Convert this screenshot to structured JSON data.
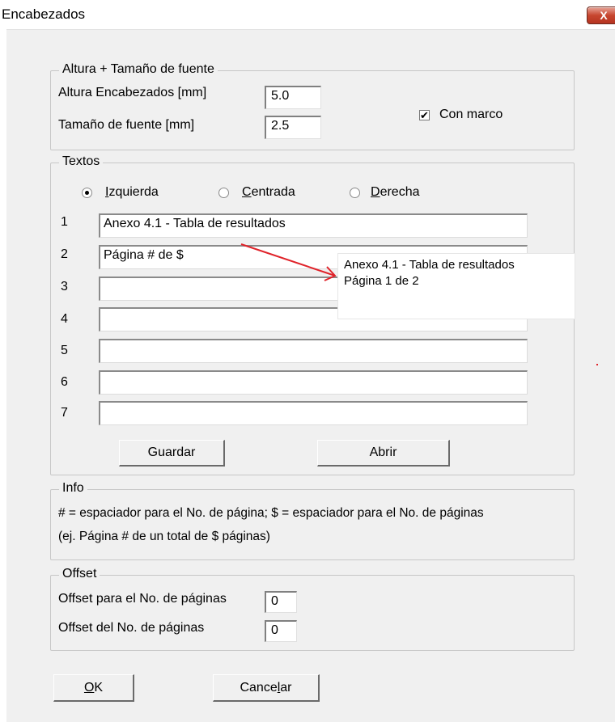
{
  "window": {
    "title": "Encabezados",
    "close_label": "X"
  },
  "group_height": {
    "legend": "Altura + Tamaño de fuente",
    "height_label": "Altura Encabezados [mm]",
    "height_value": "5.0",
    "font_label": "Tamaño de fuente [mm]",
    "font_value": "2.5",
    "frame_checked": true,
    "frame_label": "Con marco"
  },
  "group_texts": {
    "legend": "Textos",
    "alignment": [
      {
        "accel": "I",
        "rest": "zquierda",
        "selected": true
      },
      {
        "accel": "C",
        "rest": "entrada",
        "selected": false
      },
      {
        "accel": "D",
        "rest": "erecha",
        "selected": false
      }
    ],
    "rows": [
      {
        "num": "1",
        "value": "Anexo 4.1 - Tabla de resultados"
      },
      {
        "num": "2",
        "value": "Página # de $"
      },
      {
        "num": "3",
        "value": ""
      },
      {
        "num": "4",
        "value": ""
      },
      {
        "num": "5",
        "value": ""
      },
      {
        "num": "6",
        "value": ""
      },
      {
        "num": "7",
        "value": ""
      }
    ],
    "save_label": "Guardar",
    "open_label": "Abrir"
  },
  "preview": {
    "line1": "Anexo 4.1 - Tabla de resultados",
    "line2": "Página 1 de 2",
    "arrow_color": "#e0232a"
  },
  "group_info": {
    "legend": "Info",
    "line1": "# = espaciador para el No. de página; $ = espaciador para el No. de páginas",
    "line2": "(ej. Página # de un total de $ páginas)"
  },
  "group_offset": {
    "legend": "Offset",
    "pages_label": "Offset para el No. de páginas",
    "pages_value": "0",
    "page_label": "Offset del No. de páginas",
    "page_value": "0"
  },
  "footer": {
    "ok_accel": "O",
    "ok_rest": "K",
    "cancel_pre": "Cance",
    "cancel_accel": "l",
    "cancel_post": "ar"
  }
}
